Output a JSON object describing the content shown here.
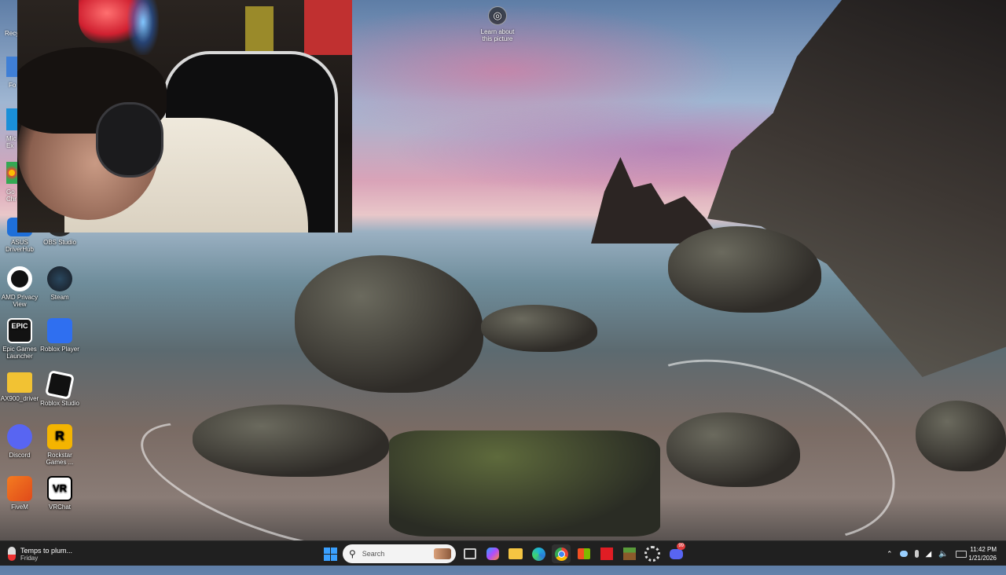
{
  "desktop": {
    "learn_picture": "Learn about this picture",
    "left_strip": [
      "Recy",
      "Fo",
      "Mic Ex",
      "Go Chr"
    ],
    "icons": [
      {
        "label": "ASUS DriverHub",
        "icon": "asus-icon",
        "color": "#1e6fd9"
      },
      {
        "label": "OBS Studio",
        "icon": "obs-icon",
        "color": "#2b2b2b"
      },
      {
        "label": "AMD Privacy View",
        "icon": "eye-icon",
        "color": "#111111"
      },
      {
        "label": "Steam",
        "icon": "steam-icon",
        "color": "#1b2838"
      },
      {
        "label": "Epic Games Launcher",
        "icon": "epic-icon",
        "color": "#121212"
      },
      {
        "label": "Roblox Player",
        "icon": "roblox-icon",
        "color": "#2f6ff0"
      },
      {
        "label": "AX900_driver",
        "icon": "folder-icon",
        "color": "#f2c233"
      },
      {
        "label": "Roblox Studio",
        "icon": "roblox-studio-icon",
        "color": "#111111"
      },
      {
        "label": "Discord",
        "icon": "discord-icon",
        "color": "#5865f2"
      },
      {
        "label": "Rockstar Games ...",
        "icon": "rockstar-icon",
        "color": "#f4b400"
      },
      {
        "label": "FiveM",
        "icon": "fivem-icon",
        "color": "#f47b20"
      },
      {
        "label": "VRChat",
        "icon": "vrchat-icon",
        "color": "#ffffff"
      }
    ]
  },
  "taskbar": {
    "weather_title": "Temps to plum...",
    "weather_sub": "Friday",
    "search_placeholder": "Search",
    "time": "11:42 PM",
    "date": "1/21/2026",
    "discord_badge": "99"
  }
}
